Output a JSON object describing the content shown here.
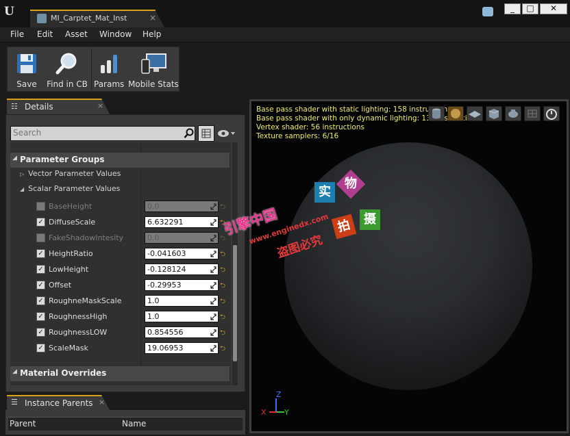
{
  "window": {
    "tab_title": "MI_Carptet_Mat_Inst",
    "close_glyph": "×",
    "min_glyph": "_",
    "max_glyph": "□",
    "win_close_glyph": "✕"
  },
  "menu": [
    "File",
    "Edit",
    "Asset",
    "Window",
    "Help"
  ],
  "toolbar": {
    "save": "Save",
    "find_in_cb": "Find in CB",
    "params": "Params",
    "mobile_stats": "Mobile Stats"
  },
  "details": {
    "tab_label": "Details",
    "search_placeholder": "Search",
    "categories": {
      "parameter_groups": "Parameter Groups",
      "vector_values": "Vector Parameter Values",
      "scalar_values": "Scalar Parameter Values",
      "material_overrides": "Material Overrides"
    },
    "params": [
      {
        "name": "BaseHeight",
        "value": "0.0",
        "enabled": false
      },
      {
        "name": "DiffuseScale",
        "value": "6.632291",
        "enabled": true
      },
      {
        "name": "FakeShadowIntesity",
        "value": "0.0",
        "enabled": false
      },
      {
        "name": "HeightRatio",
        "value": "-0.041603",
        "enabled": true
      },
      {
        "name": "LowHeight",
        "value": "-0.128124",
        "enabled": true
      },
      {
        "name": "Offset",
        "value": "-0.29953",
        "enabled": true
      },
      {
        "name": "RoughneMaskScale",
        "value": "1.0",
        "enabled": true
      },
      {
        "name": "RoughnessHigh",
        "value": "1.0",
        "enabled": true
      },
      {
        "name": "RoughnessLOW",
        "value": "0.854556",
        "enabled": true
      },
      {
        "name": "ScaleMask",
        "value": "19.06953",
        "enabled": true
      }
    ]
  },
  "instance_parents": {
    "tab_label": "Instance Parents",
    "col_parent": "Parent",
    "col_name": "Name"
  },
  "viewport": {
    "stats": [
      "Base pass shader with static lighting: 158 instructions",
      "Base pass shader with only dynamic lighting: 134 instructions",
      "Vertex shader: 56 instructions",
      "Texture samplers: 6/16"
    ],
    "axis_x": "X",
    "axis_y": "Y",
    "axis_z": "Z"
  },
  "watermark": {
    "c1": "实",
    "c2": "物",
    "c3": "拍",
    "c4": "摄",
    "line1": "引擎中国",
    "line2": "www.enginedx.com",
    "line3": "盗图必究"
  },
  "colors": {
    "accent": "#d9a21b",
    "stats_text": "#f0ed74",
    "panel_bg": "#3b3b3b"
  }
}
